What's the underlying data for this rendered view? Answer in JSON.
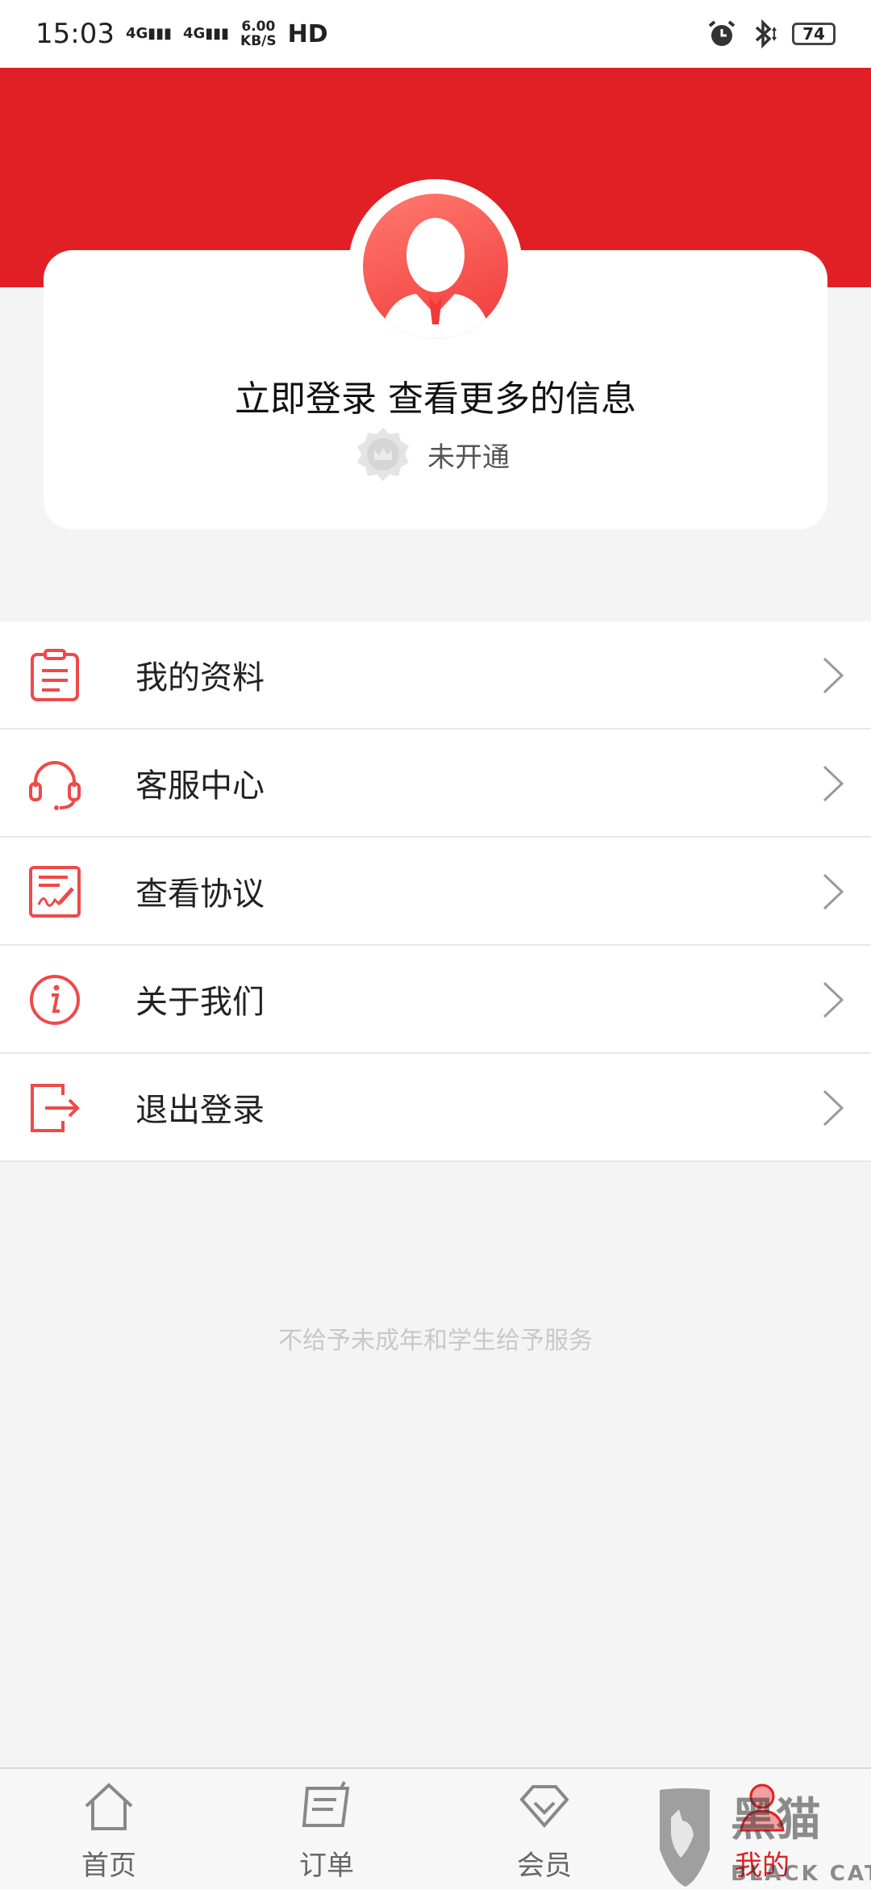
{
  "status_bar": {
    "time": "15:03",
    "sig1": "4G",
    "sig2": "4G",
    "speed_value": "6.00",
    "speed_unit": "KB/S",
    "hd": "HD",
    "battery": "74"
  },
  "profile": {
    "login_prompt": "立即登录 查看更多的信息",
    "vip_status": "未开通"
  },
  "menu": {
    "items": [
      {
        "label": "我的资料",
        "icon": "clipboard-icon"
      },
      {
        "label": "客服中心",
        "icon": "headset-icon"
      },
      {
        "label": "查看协议",
        "icon": "agreement-icon"
      },
      {
        "label": "关于我们",
        "icon": "info-icon"
      },
      {
        "label": "退出登录",
        "icon": "logout-icon"
      }
    ]
  },
  "footer_note": "不给予未成年和学生给予服务",
  "tabbar": {
    "tabs": [
      {
        "label": "首页",
        "icon": "home-icon"
      },
      {
        "label": "订单",
        "icon": "order-icon"
      },
      {
        "label": "会员",
        "icon": "member-icon"
      },
      {
        "label": "我的",
        "icon": "profile-icon",
        "active": true
      }
    ]
  },
  "watermark": {
    "text": "黑猫",
    "sub": "BLACK CAT"
  },
  "colors": {
    "brand": "#e02025",
    "background": "#f4f4f4",
    "icon_red": "#ee4a4a"
  }
}
